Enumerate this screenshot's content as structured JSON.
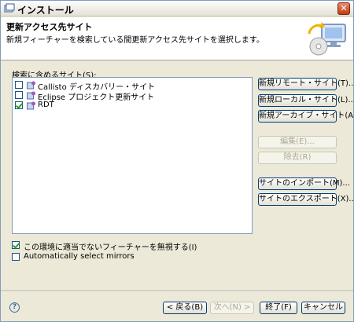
{
  "window": {
    "title": "インストール",
    "close_label": "✕"
  },
  "header": {
    "title": "更新アクセス先サイト",
    "description": "新規フィーチャーを検索している間更新アクセス先サイトを選択します。"
  },
  "sites": {
    "label": "検索に含めるサイト(S):",
    "items": [
      {
        "name": "Callisto ディスカバリー・サイト",
        "checked": false
      },
      {
        "name": "Eclipse プロジェクト更新サイト",
        "checked": false
      },
      {
        "name": "RDT",
        "checked": true
      }
    ]
  },
  "side_buttons": {
    "new_remote": "新規リモート・サイト(T)...",
    "new_local": "新規ローカル・サイト(L)...",
    "new_archive": "新規アーカイブ・サイト(A)...",
    "edit": "編集(E)...",
    "remove": "除去(R)",
    "import": "サイトのインポート(M)...",
    "export": "サイトのエクスポート(X)..."
  },
  "options": {
    "ignore_features": "この環境に適当でないフィーチャーを無視する(I)",
    "auto_mirrors": "Automatically select mirrors"
  },
  "footer": {
    "help": "?",
    "back": "< 戻る(B)",
    "next": "次へ(N) >",
    "finish": "終了(F)",
    "cancel": "キャンセル"
  }
}
